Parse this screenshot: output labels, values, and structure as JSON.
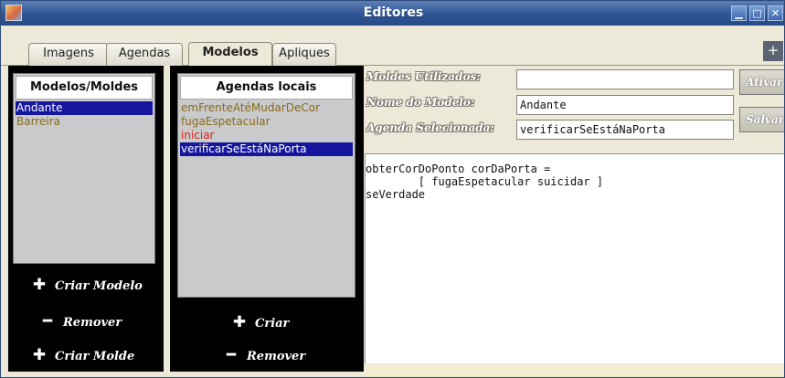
{
  "window": {
    "title": "Editores"
  },
  "tabs": [
    {
      "label": "Imagens"
    },
    {
      "label": "Agendas"
    },
    {
      "label": "Modelos"
    },
    {
      "label": "Apliques"
    }
  ],
  "models_panel": {
    "header": "Modelos/Moldes",
    "items": [
      {
        "label": "Andante",
        "color": "#ffffff",
        "selected": true
      },
      {
        "label": "Barreira",
        "color": "#8a6a1a",
        "selected": false
      }
    ],
    "buttons": {
      "create_model": "Criar Modelo",
      "remove": "Remover",
      "create_mold": "Criar Molde"
    }
  },
  "agendas_panel": {
    "header": "Agendas locais",
    "items": [
      {
        "label": "emFrenteAtéMudarDeCor",
        "color": "#8a6a1a",
        "selected": false
      },
      {
        "label": "fugaEspetacular",
        "color": "#8a6a1a",
        "selected": false
      },
      {
        "label": "iniciar",
        "color": "#e0201a",
        "selected": false
      },
      {
        "label": "verificarSeEstáNaPorta",
        "color": "#ffffff",
        "selected": true
      }
    ],
    "buttons": {
      "create": "Criar",
      "remove": "Remover"
    }
  },
  "form": {
    "molds_label": "Moldes Utilizados:",
    "molds_value": "",
    "model_name_label": "Nome do Modelo:",
    "model_name_value": "Andante",
    "agenda_label": "Agenda Selecionada:",
    "agenda_value": "verificarSeEstáNaPorta",
    "activate_button": "Ativar",
    "save_button": "Salvar"
  },
  "editor": {
    "lines": [
      "obterCorDoPonto corDaPorta =",
      "        [ fugaEspetacular suicidar ]",
      "seVerdade"
    ]
  },
  "colors": {
    "titlebar": "#2e5594",
    "selection": "#15169e",
    "list_item_default": "#8a6a1a",
    "list_item_alert": "#e0201a"
  }
}
